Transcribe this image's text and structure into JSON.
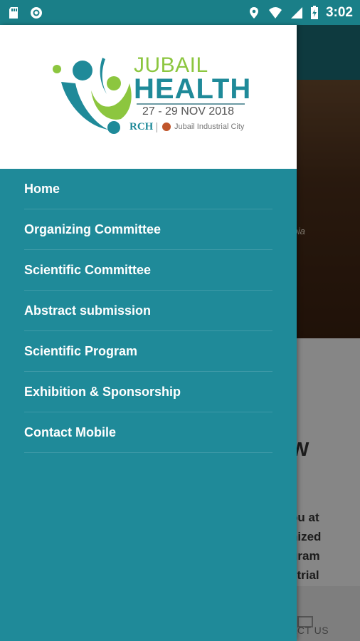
{
  "status_bar": {
    "time": "3:02",
    "left_icons": [
      "sd-card-icon",
      "notification-circle-icon"
    ],
    "right_icons": [
      "location-icon",
      "wifi-icon",
      "signal-icon",
      "battery-charging-icon"
    ]
  },
  "background": {
    "hero_caption": "rabia",
    "heading_fragment": "W",
    "paragraph_fragments": [
      "ou at",
      "nized",
      "gram",
      "strial"
    ],
    "footer_label": "ACT US"
  },
  "drawer": {
    "logo": {
      "word1": "JUBAIL",
      "word2": "HEALTH",
      "dates": "27 - 29 NOV 2018",
      "org1": "RCH",
      "org2": "Jubail Industrial City"
    },
    "menu": [
      {
        "label": "Home"
      },
      {
        "label": "Organizing Committee"
      },
      {
        "label": "Scientific Committee"
      },
      {
        "label": "Abstract submission"
      },
      {
        "label": "Scientific Program"
      },
      {
        "label": "Exhibition & Sponsorship"
      },
      {
        "label": "Contact Mobile"
      }
    ]
  },
  "colors": {
    "drawer_bg": "#1f8a99",
    "status_bar": "#1a7f88",
    "logo_green": "#8cc63f",
    "logo_teal": "#1f8a99"
  }
}
